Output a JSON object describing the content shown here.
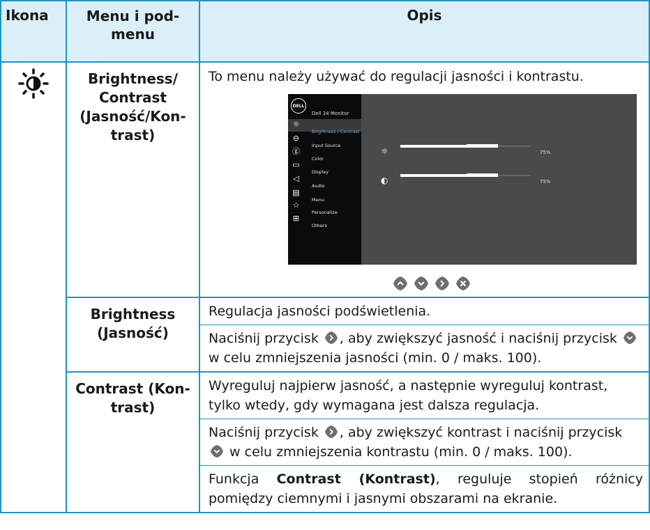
{
  "header": {
    "icon_col": "Ikona",
    "menu_col": "Menu i pod-\nmenu",
    "desc_col": "Opis"
  },
  "rows": [
    {
      "menu_label_lines": [
        "Brightness/",
        "Contrast",
        "(Jasność/Kon-",
        "trast)"
      ],
      "intro": "To menu należy używać do regulacji jasności i kontrastu.",
      "osd": {
        "model": "Dell 34 Monitor",
        "logo": "DELL",
        "items": [
          "Brightness / Contrast",
          "Input Source",
          "Color",
          "Display",
          "Audio",
          "Menu",
          "Personalize",
          "Others"
        ],
        "active_index": 0,
        "brightness_value": "75%",
        "contrast_value": "75%",
        "brightness_level": 0.75,
        "contrast_level": 0.75
      }
    },
    {
      "menu_label_lines": [
        "Brightness",
        "(Jasność)"
      ],
      "p1": "Regulacja jasności podświetlenia.",
      "p2_a": "Naciśnij przycisk ",
      "p2_b": ", aby zwiększyć jasność i naciśnij przycisk ",
      "p2_c": " w celu zmniejszenia jasności (min. 0 / maks. 100)."
    },
    {
      "menu_label_lines": [
        "Contrast (Kon-",
        "trast)"
      ],
      "p1": "Wyreguluj najpierw jasność, a następnie wyreguluj kontrast, tylko wtedy, gdy wymagana jest dalsza regulacja.",
      "p2_a": "Naciśnij przycisk ",
      "p2_b": ", aby zwiększyć kontrast i naciśnij przycisk ",
      "p2_c": " w celu zmniejszenia kontrastu (min. 0 / maks. 100).",
      "p3_a": "Funkcja ",
      "p3_bold": "Contrast (Kontrast)",
      "p3_b": ", reguluje stopień różnicy pomiędzy ciemnymi i jasnymi obszarami na ekranie."
    }
  ],
  "colors": {
    "border": "#1f93c3",
    "header_bg": "#dbeff8",
    "button": "#6e6e6e"
  },
  "icons": {
    "row_icon": "brightness-sun-icon",
    "nav": [
      "up-button-icon",
      "down-button-icon",
      "right-button-icon",
      "close-button-icon"
    ]
  }
}
